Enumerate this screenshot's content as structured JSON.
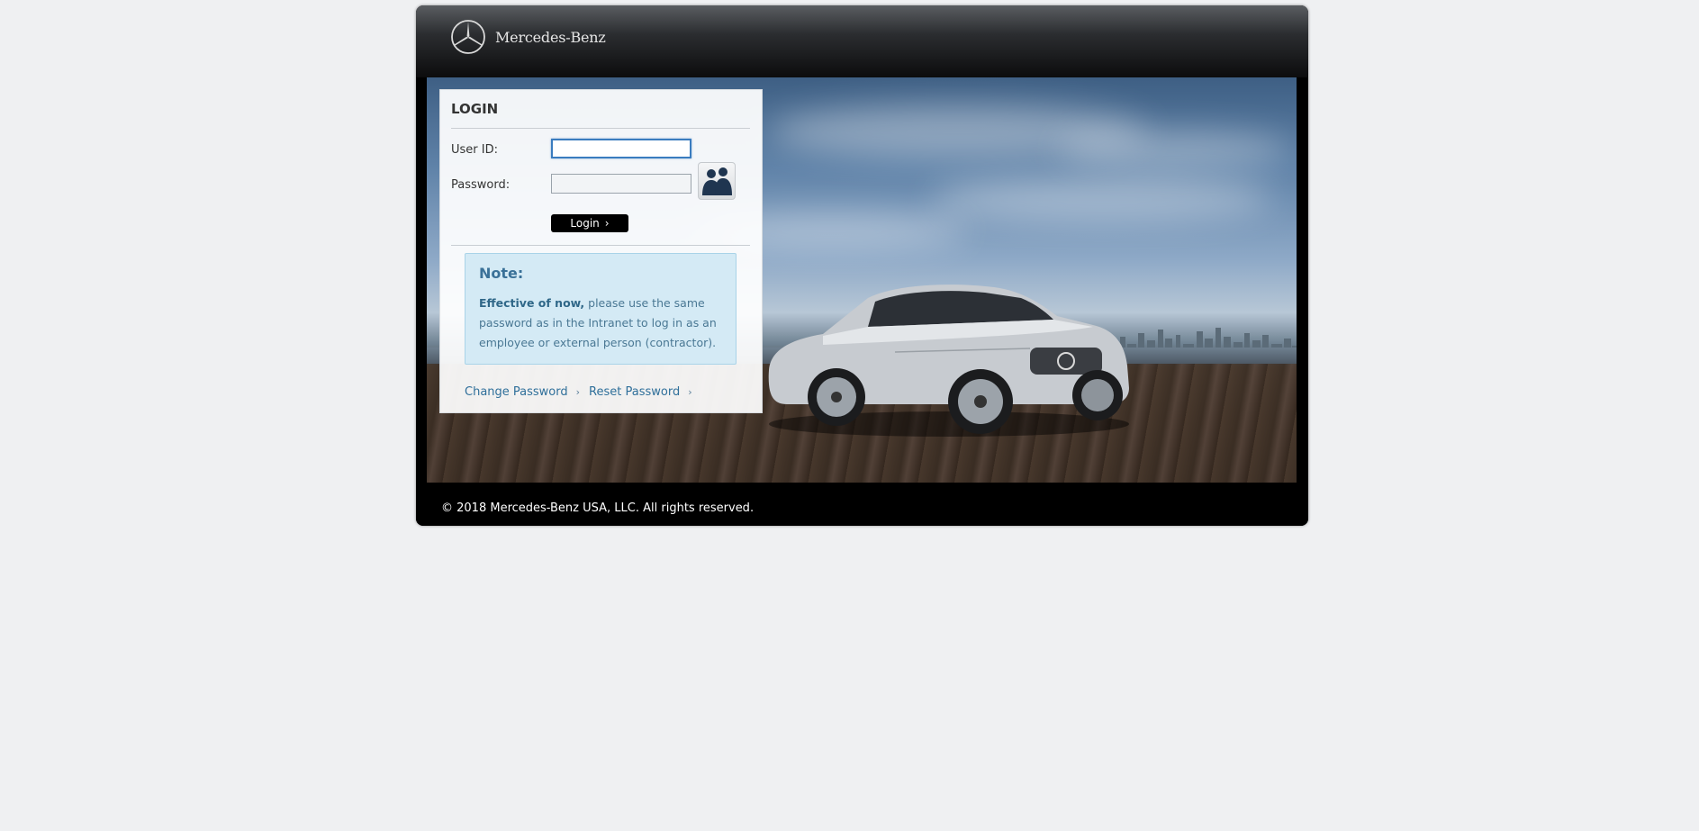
{
  "brand": {
    "name": "Mercedes-Benz",
    "logo_icon": "mercedes-star-icon"
  },
  "login": {
    "title": "LOGIN",
    "user_label": "User ID:",
    "user_value": "",
    "password_label": "Password:",
    "password_value": "",
    "button_label": "Login",
    "button_chevron": "›",
    "user_icon": "users-icon"
  },
  "note": {
    "title": "Note:",
    "emphasis": "Effective of now,",
    "text": " please use the same password as in the Intranet to log in as an employee or external person (contractor)."
  },
  "links": {
    "change_password": "Change Password",
    "reset_password": "Reset Password",
    "chevron": "›"
  },
  "footer": {
    "copyright": "© 2018 Mercedes-Benz USA, LLC. All rights reserved."
  },
  "colors": {
    "accent": "#3a7cbf",
    "note_bg": "#d4eaf5",
    "link": "#2f6f9a"
  }
}
